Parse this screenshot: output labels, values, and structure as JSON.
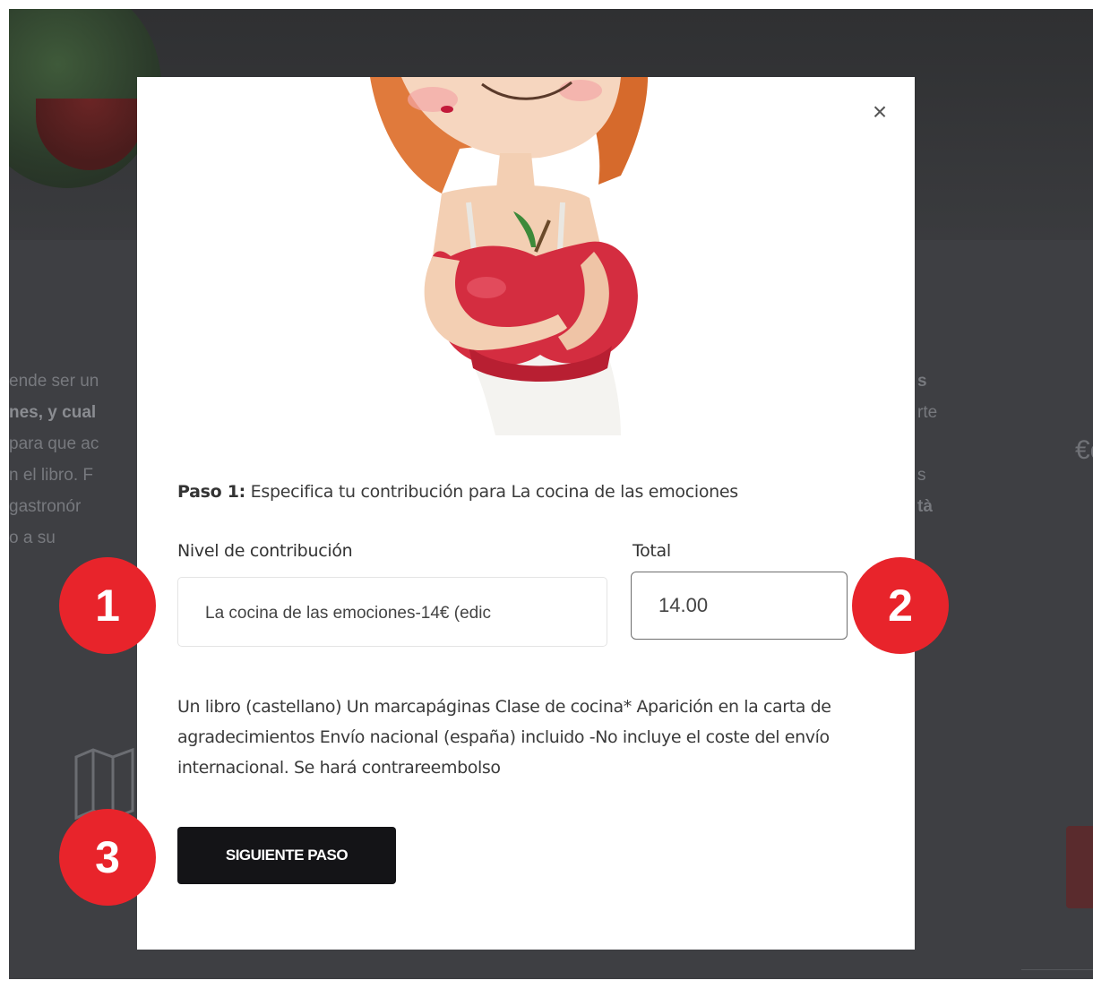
{
  "background": {
    "text_left_lines": [
      "ende ser un",
      "nes, y cual",
      "para que ac",
      "n el libro. F",
      "gastronór",
      "o a su"
    ],
    "text_right_lines": [
      "s",
      "rte",
      "",
      "s",
      "tà"
    ],
    "euro_symbol": "€c"
  },
  "modal": {
    "close_symbol": "×",
    "step_prefix": "Paso 1:",
    "step_text": " Especifica tu contribución para ",
    "project_name": "La cocina de las emociones",
    "level_label": "Nivel de contribución",
    "level_value": "La cocina de las emociones-14€ (edic",
    "total_label": "Total",
    "total_value": "14.00",
    "description": "Un libro (castellano) Un marcapáginas Clase de cocina* Aparición en la carta de agradecimientos Envío nacional (españa) incluido -No incluye el coste del envío internacional. Se hará contrareembolso",
    "next_button": "SIGUIENTE PASO"
  },
  "annotations": [
    "1",
    "2",
    "3"
  ],
  "colors": {
    "overlay": "#3e3f43",
    "badge": "#e8242b",
    "button": "#141417"
  }
}
